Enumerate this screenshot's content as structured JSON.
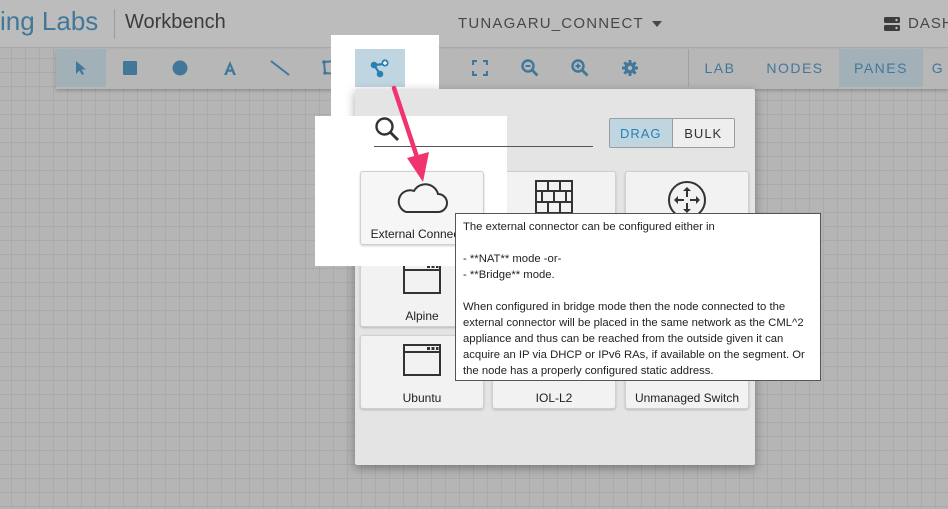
{
  "header": {
    "brand": "ing Labs",
    "app_title": "Workbench",
    "lab_name": "TUNAGARU_CONNECT",
    "dashboard_label": "DASH"
  },
  "toolbar": {
    "tools": [
      {
        "name": "select-pointer-icon",
        "active": true
      },
      {
        "name": "rectangle-icon"
      },
      {
        "name": "ellipse-icon"
      },
      {
        "name": "text-icon"
      },
      {
        "name": "line-icon"
      },
      {
        "name": "polygon-icon"
      },
      {
        "name": "add-node-icon",
        "active": true
      },
      {
        "name": "crosshair-icon"
      },
      {
        "name": "fit-screen-icon"
      },
      {
        "name": "zoom-out-icon"
      },
      {
        "name": "zoom-in-icon"
      },
      {
        "name": "gear-icon"
      }
    ],
    "tabs": [
      {
        "label": "LAB"
      },
      {
        "label": "NODES"
      },
      {
        "label": "PANES",
        "active": true
      },
      {
        "label": "G"
      }
    ]
  },
  "panel": {
    "search_placeholder": "",
    "modes": [
      "DRAG",
      "BULK"
    ],
    "active_mode": "DRAG",
    "nodes": [
      {
        "label": "External Connector",
        "icon": "cloud-icon"
      },
      {
        "label": "",
        "icon": "firewall-brick-icon"
      },
      {
        "label": "",
        "icon": "router-icon"
      },
      {
        "label": "Alpine",
        "icon": "server-window-icon"
      },
      {
        "label": "Ubuntu",
        "icon": "server-window-icon"
      },
      {
        "label": "IOL-L2",
        "icon": "switch-icon"
      },
      {
        "label": "Unmanaged Switch",
        "icon": "switch-icon"
      }
    ]
  },
  "tooltip": {
    "text": "The external connector can be configured either in\n\n- **NAT** mode -or-\n- **Bridge** mode.\n\nWhen configured in bridge mode then the node connected to the external connector will be placed in the same network as the CML^2 appliance and thus can be reached from the outside given it can acquire an IP via DHCP or IPv6 RAs, if available on the segment. Or the node has a properly configured static address."
  },
  "colors": {
    "accent": "#2a7fb3",
    "active_bg": "#bfd6e0",
    "annotation_arrow": "#f0346f"
  }
}
